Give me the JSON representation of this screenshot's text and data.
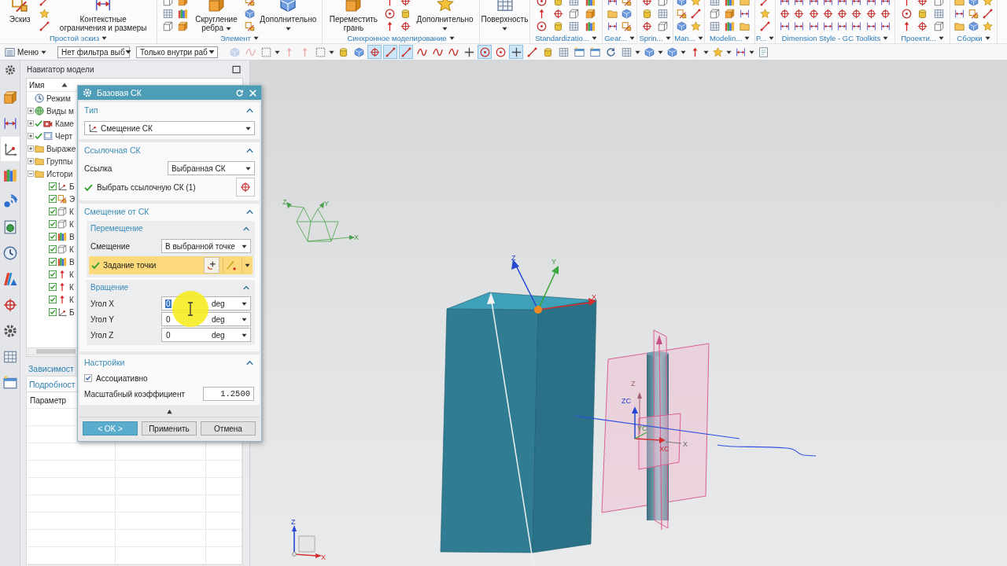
{
  "ribbon": {
    "groups": [
      {
        "label": "Простой эскиз",
        "buttons": [
          {
            "label": "Эскиз",
            "menu": false
          },
          {
            "label": "Контекстные ограничения и размеры",
            "menu": false
          }
        ]
      },
      {
        "label": "Элемент",
        "buttons": [
          {
            "label": "Скругление ребра",
            "menu": true
          },
          {
            "label": "Дополнительно",
            "menu": true
          }
        ]
      },
      {
        "label": "Синхронное моделирование",
        "buttons": [
          {
            "label": "Переместить грань",
            "menu": false
          },
          {
            "label": "Дополнительно",
            "menu": true
          }
        ]
      },
      {
        "buttons": [
          {
            "label": "Поверхность",
            "menu": true
          }
        ]
      },
      {
        "label": "Standardizatio..."
      },
      {
        "label": "Gear..."
      },
      {
        "label": "Sprin..."
      },
      {
        "label": "Man..."
      },
      {
        "label": "Modelin..."
      },
      {
        "label": "P..."
      },
      {
        "label": "Dimension Style - GC Toolkits"
      },
      {
        "label": "Проекти..."
      },
      {
        "label": "Сборки"
      }
    ]
  },
  "toolbar": {
    "menu": "Меню",
    "filters": [
      "Нет фильтра выб",
      "Только внутри раб"
    ],
    "tools": [
      {
        "on": false,
        "disabled": true
      },
      {
        "on": false,
        "disabled": true
      },
      {
        "on": false,
        "disabled": false
      },
      {
        "on": false,
        "disabled": true
      },
      {
        "on": false,
        "disabled": true
      },
      {
        "on": false,
        "disabled": false
      },
      {
        "on": false,
        "disabled": false
      },
      {
        "on": false,
        "disabled": false
      },
      {
        "on": true,
        "disabled": false
      },
      {
        "on": true,
        "disabled": false
      },
      {
        "on": true,
        "disabled": false
      },
      {
        "on": false,
        "disabled": false
      },
      {
        "on": false,
        "disabled": false
      },
      {
        "on": false,
        "disabled": false
      },
      {
        "on": false,
        "disabled": false
      },
      {
        "on": true,
        "disabled": false
      },
      {
        "on": false,
        "disabled": false
      },
      {
        "on": true,
        "disabled": false
      },
      {
        "on": false,
        "disabled": false
      },
      {
        "on": false,
        "disabled": false
      },
      {
        "on": false,
        "disabled": false
      },
      {
        "on": false,
        "disabled": false
      },
      {
        "on": false,
        "disabled": false
      },
      {
        "on": false,
        "disabled": false
      },
      {
        "on": false,
        "disabled": false
      },
      {
        "on": false,
        "disabled": false
      },
      {
        "on": false,
        "disabled": false
      },
      {
        "on": false,
        "disabled": false
      },
      {
        "on": false,
        "disabled": false
      },
      {
        "on": false,
        "disabled": false
      },
      {
        "on": false,
        "disabled": false
      }
    ]
  },
  "resource_bar": {
    "tabs": [
      {
        "selected": false
      },
      {
        "selected": false
      },
      {
        "selected": true
      },
      {
        "selected": false
      },
      {
        "selected": false
      },
      {
        "selected": false
      },
      {
        "selected": false
      },
      {
        "selected": false
      },
      {
        "selected": false
      },
      {
        "selected": false
      },
      {
        "selected": false
      },
      {
        "selected": false
      }
    ]
  },
  "navigator": {
    "title": "Навигатор модели",
    "column": "Имя",
    "nodes": [
      {
        "label": "Режим",
        "kind": "mode",
        "checked": false
      },
      {
        "label": "Виды м",
        "kind": "views",
        "checked": false,
        "expanded": false
      },
      {
        "label": "Каме",
        "kind": "camera",
        "checked": true,
        "expanded": false
      },
      {
        "label": "Черт",
        "kind": "drawing",
        "checked": true,
        "expanded": false
      },
      {
        "label": "Выраже",
        "kind": "folder",
        "checked": false,
        "expanded": false
      },
      {
        "label": "Группы",
        "kind": "folder",
        "checked": false,
        "expanded": false
      },
      {
        "label": "Истори",
        "kind": "folder",
        "checked": false,
        "expanded": true,
        "children": [
          {
            "label": "Б",
            "kind": "csys",
            "checked": true
          },
          {
            "label": "Э",
            "kind": "sketch",
            "checked": true
          },
          {
            "label": "К",
            "kind": "block",
            "checked": true
          },
          {
            "label": "К",
            "kind": "block",
            "checked": true
          },
          {
            "label": "В",
            "kind": "feature",
            "checked": true
          },
          {
            "label": "К",
            "kind": "block",
            "checked": true
          },
          {
            "label": "В",
            "kind": "feature",
            "checked": true
          },
          {
            "label": "К",
            "kind": "arrow",
            "checked": true
          },
          {
            "label": "К",
            "kind": "arrow",
            "checked": true
          },
          {
            "label": "К",
            "kind": "arrow",
            "checked": true
          },
          {
            "label": "Б",
            "kind": "csys",
            "checked": true
          }
        ]
      }
    ],
    "sections": [
      "Зависимост",
      "Подробност"
    ],
    "table": {
      "columns": [
        "Параметр"
      ]
    }
  },
  "viewport": {
    "wcs_triad": {
      "labels": [
        "Z",
        "Y",
        "X"
      ]
    },
    "datum_csys": {
      "labels": [
        "Z",
        "Y",
        "X"
      ]
    },
    "work_csys": {
      "labels": [
        "Z",
        "ZC",
        "YC",
        "XC",
        "X"
      ]
    },
    "view_triad": {
      "labels": [
        "Z",
        "X"
      ]
    }
  },
  "dialog": {
    "title": "Базовая СК",
    "sections": [
      {
        "kind": "type",
        "title": "Тип",
        "expanded": true,
        "select": "Смещение СК"
      },
      {
        "kind": "reference",
        "title": "Ссылочная СК",
        "expanded": true,
        "field": {
          "label": "Ссылка",
          "value": "Выбранная СК"
        },
        "pick": {
          "label": "Выбрать ссылочную СК (1)",
          "done": true
        }
      },
      {
        "kind": "offset",
        "title": "Смещение от СК",
        "expanded": true,
        "groups": [
          {
            "kind": "move",
            "title": "Перемещение",
            "expanded": true,
            "field": {
              "label": "Смещение",
              "value": "В выбранной точке"
            },
            "pick": {
              "label": "Задание точки",
              "done": true,
              "active": true
            }
          },
          {
            "kind": "rotate",
            "title": "Вращение",
            "expanded": true,
            "angles": [
              {
                "label": "Угол X",
                "value": "0",
                "unit": "deg",
                "highlighted": true
              },
              {
                "label": "Угол Y",
                "value": "0",
                "unit": "deg",
                "highlighted": false
              },
              {
                "label": "Угол Z",
                "value": "0",
                "unit": "deg",
                "highlighted": false
              }
            ]
          }
        ]
      },
      {
        "kind": "settings",
        "title": "Настройки",
        "expanded": true,
        "checkbox": {
          "label": "Ассоциативно",
          "checked": true
        },
        "field": {
          "label": "Масштабный коэффициент",
          "value": "1.2500"
        }
      }
    ],
    "buttons": [
      {
        "label": "< OK >",
        "kind": "primary"
      },
      {
        "label": "Применить",
        "kind": "normal"
      },
      {
        "label": "Отмена",
        "kind": "normal"
      }
    ]
  }
}
